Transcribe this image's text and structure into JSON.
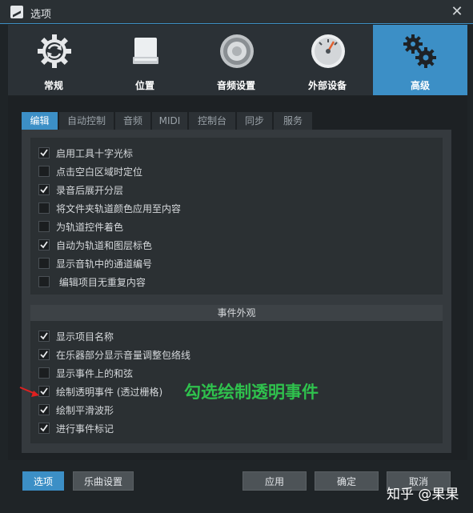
{
  "window": {
    "title": "选项",
    "close_glyph": "✕"
  },
  "categories": [
    {
      "label": "常规",
      "icon": "refresh-gear-icon",
      "active": false
    },
    {
      "label": "位置",
      "icon": "drive-icon",
      "active": false
    },
    {
      "label": "音频设置",
      "icon": "speaker-icon",
      "active": false
    },
    {
      "label": "外部设备",
      "icon": "gauge-icon",
      "active": false
    },
    {
      "label": "高级",
      "icon": "gears-icon",
      "active": true
    }
  ],
  "tabs": [
    "编辑",
    "自动控制",
    "音频",
    "MIDI",
    "控制台",
    "同步",
    "服务"
  ],
  "active_tab": 0,
  "general_options": [
    {
      "label": "启用工具十字光标",
      "checked": true
    },
    {
      "label": "点击空白区域时定位",
      "checked": false
    },
    {
      "label": "录音后展开分层",
      "checked": true
    },
    {
      "label": "将文件夹轨道颜色应用至内容",
      "checked": false
    },
    {
      "label": "为轨道控件着色",
      "checked": false
    },
    {
      "label": "自动为轨道和图层标色",
      "checked": true
    },
    {
      "label": "显示音轨中的通道编号",
      "checked": false
    },
    {
      "label": " 编辑项目无重复内容",
      "checked": false
    }
  ],
  "event_appearance": {
    "header": "事件外观",
    "options": [
      {
        "label": "显示项目名称",
        "checked": true
      },
      {
        "label": "在乐器部分显示音量调整包络线",
        "checked": true
      },
      {
        "label": "显示事件上的和弦",
        "checked": false
      },
      {
        "label": "绘制透明事件 (透过栅格)",
        "checked": true
      },
      {
        "label": "绘制平滑波形",
        "checked": true
      },
      {
        "label": "进行事件标记",
        "checked": true
      }
    ]
  },
  "buttons": {
    "options": "选项",
    "song_settings": "乐曲设置",
    "apply": "应用",
    "ok": "确定",
    "cancel": "取消"
  },
  "annotation": "勾选绘制透明事件",
  "watermark": "知乎 @果果",
  "colors": {
    "accent": "#3c8fc6",
    "annotation": "#2fc14d",
    "arrow": "#e02020"
  }
}
